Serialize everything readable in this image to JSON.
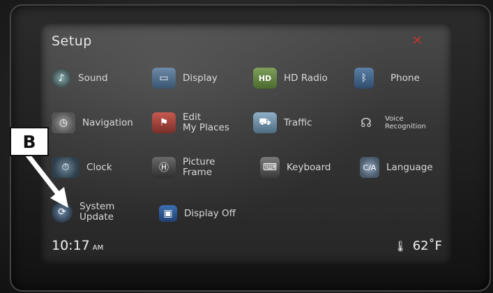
{
  "screen": {
    "title": "Setup",
    "close": "✕"
  },
  "tiles": [
    {
      "label": "Sound",
      "icon": "sound-icon"
    },
    {
      "label": "Display",
      "icon": "display-icon"
    },
    {
      "label": "HD Radio",
      "icon": "hd-radio-icon"
    },
    {
      "label": "Phone",
      "icon": "bluetooth-icon"
    },
    {
      "label": "Navigation",
      "icon": "navigation-icon"
    },
    {
      "label": "Edit\nMy Places",
      "icon": "my-places-icon"
    },
    {
      "label": "Traffic",
      "icon": "traffic-icon"
    },
    {
      "label": "Voice\nRecognition",
      "icon": "voice-icon"
    },
    {
      "label": "Clock",
      "icon": "clock-icon"
    },
    {
      "label": "Picture\nFrame",
      "icon": "picture-frame-icon"
    },
    {
      "label": "Keyboard",
      "icon": "keyboard-icon"
    },
    {
      "label": "Language",
      "icon": "language-icon"
    },
    {
      "label": "System\nUpdate",
      "icon": "system-update-icon"
    },
    {
      "label": "Display Off",
      "icon": "display-off-icon"
    }
  ],
  "status": {
    "time": "10:17",
    "ampm": "AM",
    "temperature": "62˚F"
  },
  "callout": {
    "letter": "B"
  },
  "colors": {
    "close": "#c0332c",
    "screen_bg": "#343434",
    "text": "#d9d9d9"
  }
}
